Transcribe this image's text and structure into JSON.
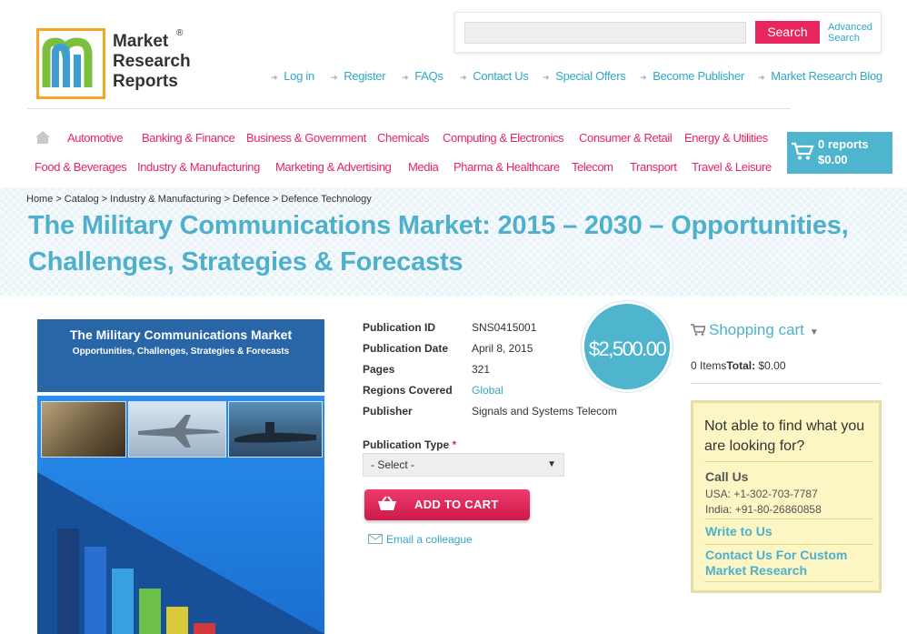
{
  "header": {
    "logo_lines": [
      "Market",
      "Research",
      "Reports"
    ],
    "logo_reg": "®",
    "search": {
      "placeholder": "",
      "button": "Search",
      "advanced": "Advanced Search"
    },
    "top_links": [
      "Log in",
      "Register",
      "FAQs",
      "Contact Us",
      "Special Offers",
      "Become Publisher",
      "Market Research Blog"
    ]
  },
  "categories": {
    "row1": [
      "Automotive",
      "Banking & Finance",
      "Business & Government",
      "Chemicals",
      "Computing & Electronics",
      "Consumer & Retail",
      "Energy & Utilities"
    ],
    "row2": [
      "Food & Beverages",
      "Industry & Manufacturing",
      "Marketing & Advertising",
      "Media",
      "Pharma & Healthcare",
      "Telecom",
      "Transport",
      "Travel & Leisure"
    ]
  },
  "mini_cart": {
    "reports": "0 reports",
    "total": "$0.00"
  },
  "breadcrumb": [
    "Home",
    "Catalog",
    "Industry & Manufacturing",
    "Defence",
    "Defence Technology"
  ],
  "breadcrumb_sep": ">",
  "page_title": "The Military Communications Market: 2015 – 2030 – Opportunities, Challenges, Strategies & Forecasts",
  "cover": {
    "title": "The Military Communications Market",
    "subtitle": "Opportunities, Challenges, Strategies & Forecasts"
  },
  "details": {
    "publication_id": {
      "label": "Publication ID",
      "value": "SNS0415001"
    },
    "publication_date": {
      "label": "Publication Date",
      "value": "April 8, 2015"
    },
    "pages": {
      "label": "Pages",
      "value": "321"
    },
    "regions": {
      "label": "Regions Covered",
      "value": "Global"
    },
    "publisher": {
      "label": "Publisher",
      "value": "Signals and Systems Telecom"
    }
  },
  "price": "$2,500.00",
  "publication_type": {
    "label": "Publication Type",
    "required": "*",
    "selected": "- Select -"
  },
  "add_to_cart": "ADD TO CART",
  "email_colleague": "Email a colleague",
  "shopping_cart": {
    "title": "Shopping cart",
    "items": "0 Items",
    "total_label": "Total:",
    "total": "$0.00"
  },
  "help": {
    "title": "Not able to find what you are looking for?",
    "call_us": "Call Us",
    "usa": "USA: +1-302-703-7787",
    "india": "India: +91-80-26860858",
    "write": "Write to Us",
    "custom": "Contact Us For Custom Market Research"
  },
  "colors": {
    "accent_pink": "#e8265e",
    "accent_blue": "#4fb0cc",
    "link_blue": "#2fa7c9"
  }
}
